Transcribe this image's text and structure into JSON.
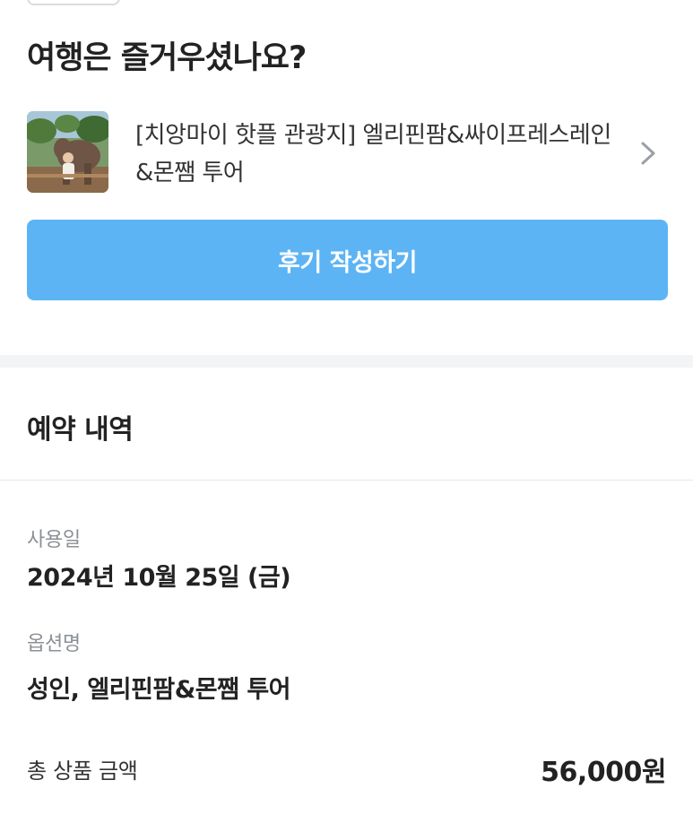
{
  "header": {
    "title": "여행은 즐거우셨나요?"
  },
  "product": {
    "title": "[치앙마이 핫플 관광지] 엘리핀팜&싸이프레스레인&몬쨈 투어",
    "thumbnail_icon": "product-photo",
    "chevron_icon": "chevron-right-icon"
  },
  "actions": {
    "write_review_label": "후기 작성하기",
    "accent_color": "#5db4f4"
  },
  "reservation": {
    "section_title": "예약 내역",
    "use_date_label": "사용일",
    "use_date_value": "2024년 10월 25일 (금)",
    "option_label": "옵션명",
    "option_value": "성인, 엘리핀팜&몬쨈 투어",
    "total_label": "총 상품 금액",
    "total_value": "56,000원"
  }
}
